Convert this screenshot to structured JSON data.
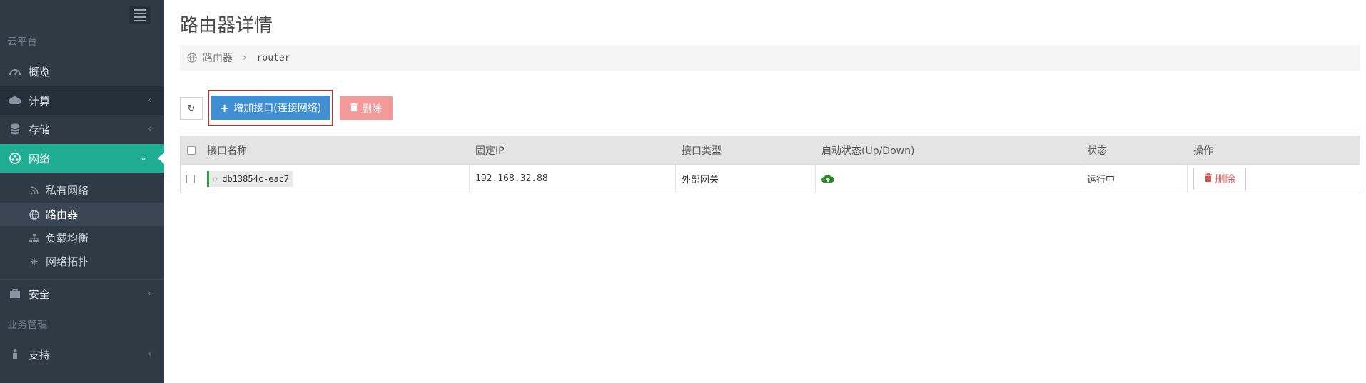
{
  "sidebar": {
    "section_cloud": "云平台",
    "items": [
      {
        "label": "概览",
        "icon": "dashboard-icon"
      },
      {
        "label": "计算",
        "icon": "cloud-icon"
      },
      {
        "label": "存储",
        "icon": "database-icon"
      },
      {
        "label": "网络",
        "icon": "network-icon"
      }
    ],
    "sub_items": [
      {
        "label": "私有网络",
        "icon": "rss-icon"
      },
      {
        "label": "路由器",
        "icon": "globe-icon"
      },
      {
        "label": "负载均衡",
        "icon": "sitemap-icon"
      },
      {
        "label": "网络拓扑",
        "icon": "gear-icon"
      }
    ],
    "security_label": "安全",
    "section_business": "业务管理",
    "support_label": "支持"
  },
  "page": {
    "title": "路由器详情"
  },
  "breadcrumb": {
    "parent": "路由器",
    "current": "router"
  },
  "toolbar": {
    "add_label": "增加接口(连接网络)",
    "delete_label": "删除"
  },
  "table": {
    "headers": [
      "接口名称",
      "固定IP",
      "接口类型",
      "启动状态(Up/Down)",
      "状态",
      "操作"
    ],
    "rows": [
      {
        "name": "db13854c-eac7",
        "ip": "192.168.32.88",
        "type": "外部网关",
        "status": "运行中",
        "action": "删除"
      }
    ]
  },
  "colors": {
    "sidebar_bg": "#2f3a45",
    "active_accent": "#1fae94",
    "primary_button": "#3f8fd2",
    "danger_soft": "#f3999a",
    "up_status": "#2a9d3a"
  }
}
